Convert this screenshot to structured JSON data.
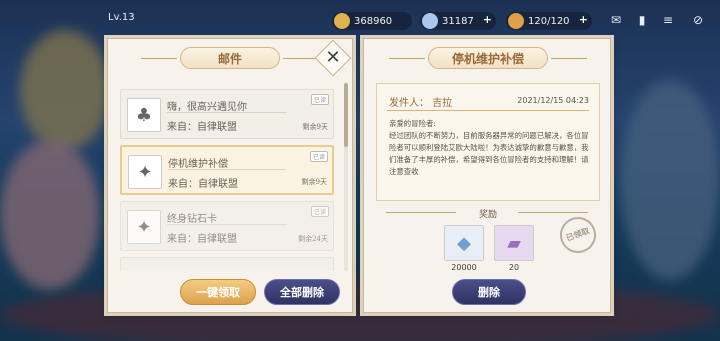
{
  "hud": {
    "level": "Lv.13",
    "resources": [
      {
        "name": "gold-coin",
        "value": "368960",
        "color": "#e0b24d"
      },
      {
        "name": "diamond",
        "value": "31187",
        "color": "#a8c6f0"
      },
      {
        "name": "stamina",
        "value": "120/120",
        "color": "#e0a048"
      }
    ]
  },
  "mailbox": {
    "title": "邮件",
    "items": [
      {
        "title": "嗨，很高兴遇见你",
        "from": "来自：自律联盟",
        "expire": "剩余9天",
        "status": "已读"
      },
      {
        "title": "停机维护补偿",
        "from": "来自：自律联盟",
        "expire": "剩余9天",
        "status": "已读"
      },
      {
        "title": "终身钻石卡",
        "from": "来自：自律联盟",
        "expire": "剩余24天",
        "status": "已读"
      }
    ],
    "claim_all_label": "一键领取",
    "delete_all_label": "全部删除"
  },
  "detail": {
    "title": "停机维护补偿",
    "sender": "发件人： 吉拉",
    "date": "2021/12/15 04:23",
    "greeting": "亲爱的冒险者:",
    "body": "经过团队的不断努力，目前服务器异常的问题已解决，各位冒险者可以顺利登陆艾欧大陆啦！为表达诚挚的歉意与歉意，我们准备了丰厚的补偿，希望得到各位冒险者的支持和理解！请注意查收",
    "rewards_label": "奖励",
    "rewards": [
      {
        "icon": "diamond-icon",
        "count": "20000"
      },
      {
        "icon": "card-icon",
        "count": "20"
      }
    ],
    "claimed_stamp": "已领取",
    "delete_label": "删除"
  },
  "colors": {
    "accent_gold": "#dea24d",
    "navy": "#2f3262",
    "paper": "#f7f3ec"
  }
}
